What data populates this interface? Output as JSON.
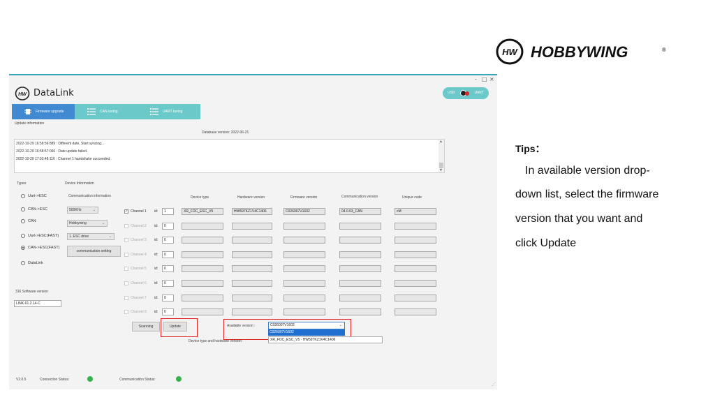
{
  "brand": {
    "name": "HOBBYWING",
    "registered": "®",
    "logo_mark": "HW"
  },
  "window": {
    "minimize": "-",
    "maximize": "□",
    "close": "×",
    "title": "DataLink"
  },
  "toggle": {
    "left_label": "USB",
    "right_label": "UART"
  },
  "tabs": [
    {
      "label": "Firmware upgrade",
      "icon": "chip-icon"
    },
    {
      "label": "CAN tuning",
      "icon": "list-icon"
    },
    {
      "label": "UART tuning",
      "icon": "list-icon"
    }
  ],
  "update_info": {
    "label": "Update information",
    "database_version": "Database version: 2022-06-21",
    "log": [
      "2022-10-29 16:58:56:889 : Different date, Start syncing...",
      "2022-10-29 16:58:57:066 : Date update failed.",
      "2022-10-29 17:03:48:116 : Channel 1 handshake succeeded."
    ]
  },
  "types": {
    "label": "Types",
    "options": [
      "Uart->ESC",
      "CAN->ESC",
      "CAN",
      "Uart->ESC(FAST)",
      "CAN->ESC(FAST)",
      "DataLink"
    ],
    "selected_index": 4
  },
  "software": {
    "label": "316 Software version",
    "value": "LINK-01.2.14-C"
  },
  "device_info": {
    "label": "Device Information",
    "comm_info_label": "Communication information",
    "baud": "500KHz",
    "brand": "Hobbywing",
    "mode": "1. ESC drive",
    "comm_setting": "communication setting",
    "headers": {
      "device_type": "Device type",
      "hardware": "Hardware version",
      "firmware": "Firmware version",
      "comm": "Communication version",
      "unique": "Unique code"
    },
    "id_label": "id:",
    "channels": [
      {
        "label": "Channel 1",
        "checked": true,
        "id": "1",
        "device_type": "XR_FOC_ESC_V5",
        "hardware": "HW597KZ1V4C1406",
        "firmware": "C026007V1602",
        "comm": "04.0.03_CAN",
        "unique": "cM"
      },
      {
        "label": "Channel 2",
        "checked": false,
        "id": "0",
        "device_type": "",
        "hardware": "",
        "firmware": "",
        "comm": "",
        "unique": ""
      },
      {
        "label": "Channel 3",
        "checked": false,
        "id": "0",
        "device_type": "",
        "hardware": "",
        "firmware": "",
        "comm": "",
        "unique": ""
      },
      {
        "label": "Channel 4",
        "checked": false,
        "id": "0",
        "device_type": "",
        "hardware": "",
        "firmware": "",
        "comm": "",
        "unique": ""
      },
      {
        "label": "Channel 5",
        "checked": false,
        "id": "0",
        "device_type": "",
        "hardware": "",
        "firmware": "",
        "comm": "",
        "unique": ""
      },
      {
        "label": "Channel 6",
        "checked": false,
        "id": "0",
        "device_type": "",
        "hardware": "",
        "firmware": "",
        "comm": "",
        "unique": ""
      },
      {
        "label": "Channel 7",
        "checked": false,
        "id": "0",
        "device_type": "",
        "hardware": "",
        "firmware": "",
        "comm": "",
        "unique": ""
      },
      {
        "label": "Channel 8",
        "checked": false,
        "id": "0",
        "device_type": "",
        "hardware": "",
        "firmware": "",
        "comm": "",
        "unique": ""
      }
    ]
  },
  "actions": {
    "scanning": "Scanning",
    "update": "Update",
    "available_label": "Available version :",
    "available_value": "C026007V1602",
    "available_option": "C026007V1602",
    "dev_hw_label": "Device type and hardware version:",
    "dev_hw_value": "XR_FOC_ESC_V5 · HW597KZ1V4C1406"
  },
  "status": {
    "version": "V2.0.5",
    "connection": "Connection Status:",
    "communication": "Communication Status:",
    "led_color": "#37b24d"
  },
  "tips": {
    "title": "Tips：",
    "lines": [
      "In  available version drop-",
      "down list, select the firmware",
      "version that you want and",
      "click Update"
    ]
  },
  "colors": {
    "accent": "#3aa6b9",
    "tab": "#6cc9c9",
    "tab_active": "#3f8ad0",
    "highlight": "#e02020"
  }
}
